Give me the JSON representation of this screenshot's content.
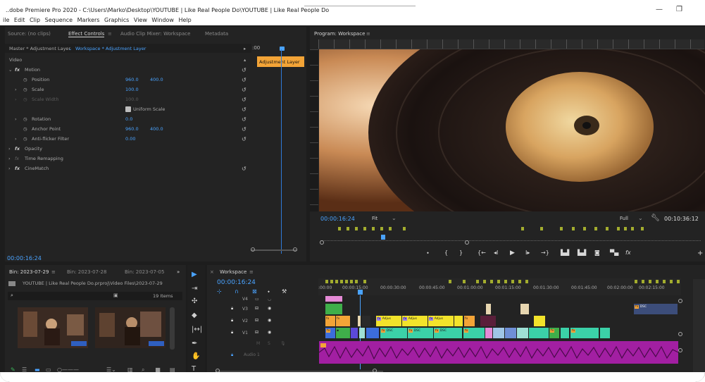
{
  "titlebar": {
    "title": "..dobe Premiere Pro 2020 - C:\\Users\\Marko\\Desktop\\YOUTUBE | Like Real People Do\\YOUTUBE | Like Real People Do",
    "min_label": "—",
    "max_label": "❐"
  },
  "menu": [
    "ile",
    "Edit",
    "Clip",
    "Sequence",
    "Markers",
    "Graphics",
    "View",
    "Window",
    "Help"
  ],
  "effect_panel": {
    "tabs": {
      "source": "Source: (no clips)",
      "effect_controls": "Effect Controls",
      "audio_mixer": "Audio Clip Mixer: Workspace",
      "metadata": "Metadata"
    },
    "master_label": "Master * Adjustment Layer",
    "sequence_label": "Workspace * Adjustment Layer",
    "time_start": ":00",
    "clip_label": "Adjustment Layer",
    "video_label": "Video",
    "rows": {
      "motion": "Motion",
      "position": "Position",
      "position_x": "960.0",
      "position_y": "400.0",
      "scale": "Scale",
      "scale_val": "100.0",
      "scale_width": "Scale Width",
      "scale_width_val": "100.0",
      "uniform_scale": "Uniform Scale",
      "rotation": "Rotation",
      "rotation_val": "0.0",
      "anchor": "Anchor Point",
      "anchor_x": "960.0",
      "anchor_y": "400.0",
      "antiflicker": "Anti-flicker Filter",
      "antiflicker_val": "0.00",
      "opacity": "Opacity",
      "time_remap": "Time Remapping",
      "cinematch": "CineMatch"
    },
    "timecode": "00:00:16:24"
  },
  "program": {
    "title": "Program: Workspace",
    "timecode": "00:00:16:24",
    "fit": "Fit",
    "quality": "Full",
    "duration": "00:10:36:12"
  },
  "bins": {
    "tabs": [
      "Bin: 2023-07-29",
      "Bin: 2023-07-28",
      "Bin: 2023-07-05"
    ],
    "path": "YOUTUBE  |  Like Real People Do.prproj\\Video Files\\2023-07-29",
    "items_count": "19 Items"
  },
  "timeline": {
    "sequence_name": "Workspace",
    "timecode": "00:00:16:24",
    "ruler": [
      ":00:00",
      "00:00:15:00",
      "00:00:30:00",
      "00:00:45:00",
      "00:01:00:00",
      "00:01:15:00",
      "00:01:30:00",
      "00:01:45:00",
      "00:02:00:00",
      "00:02:15:00"
    ],
    "tracks": [
      "V4",
      "V3",
      "V2",
      "V1"
    ],
    "audio_track": "Audio 1",
    "clip_label_adjust": "Adjus",
    "clip_label_num": "DSC"
  },
  "colors": {
    "accent": "#4aa3ff",
    "adjustment": "#f3a437",
    "audio": "#b01fb0",
    "marker": "#a3ad2e"
  }
}
